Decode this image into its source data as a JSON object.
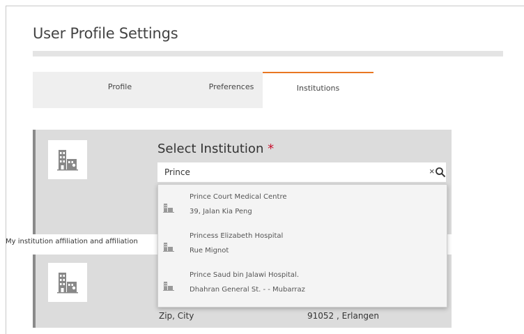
{
  "page": {
    "title": "User Profile Settings"
  },
  "tabs": [
    {
      "label": "Profile",
      "active": false
    },
    {
      "label": "Preferences",
      "active": false
    },
    {
      "label": "Institutions",
      "active": true
    }
  ],
  "colors": {
    "accent": "#e87722",
    "required": "#c8102e",
    "card_bg": "#dcdcdc",
    "card_border": "#8a8a8a"
  },
  "institution_select": {
    "label": "Select Institution",
    "required_marker": "*",
    "search_value": "Prince",
    "clear_glyph": "×",
    "icons": {
      "clear": "close-icon",
      "search": "search-icon",
      "building": "building-icon"
    }
  },
  "suggestions": [
    {
      "name": "Prince Court Medical Centre",
      "address": "39, Jalan Kia Peng"
    },
    {
      "name": "Princess Elizabeth Hospital",
      "address": "Rue Mignot"
    },
    {
      "name": "Prince Saud bin Jalawi Hospital.",
      "address": "Dhahran General St. - - Mubarraz"
    }
  ],
  "affiliation": {
    "text": "My institution affiliation and affiliation"
  },
  "current_institution": {
    "zip_city_label": "Zip, City",
    "zip_city_value": "91052 , Erlangen"
  }
}
